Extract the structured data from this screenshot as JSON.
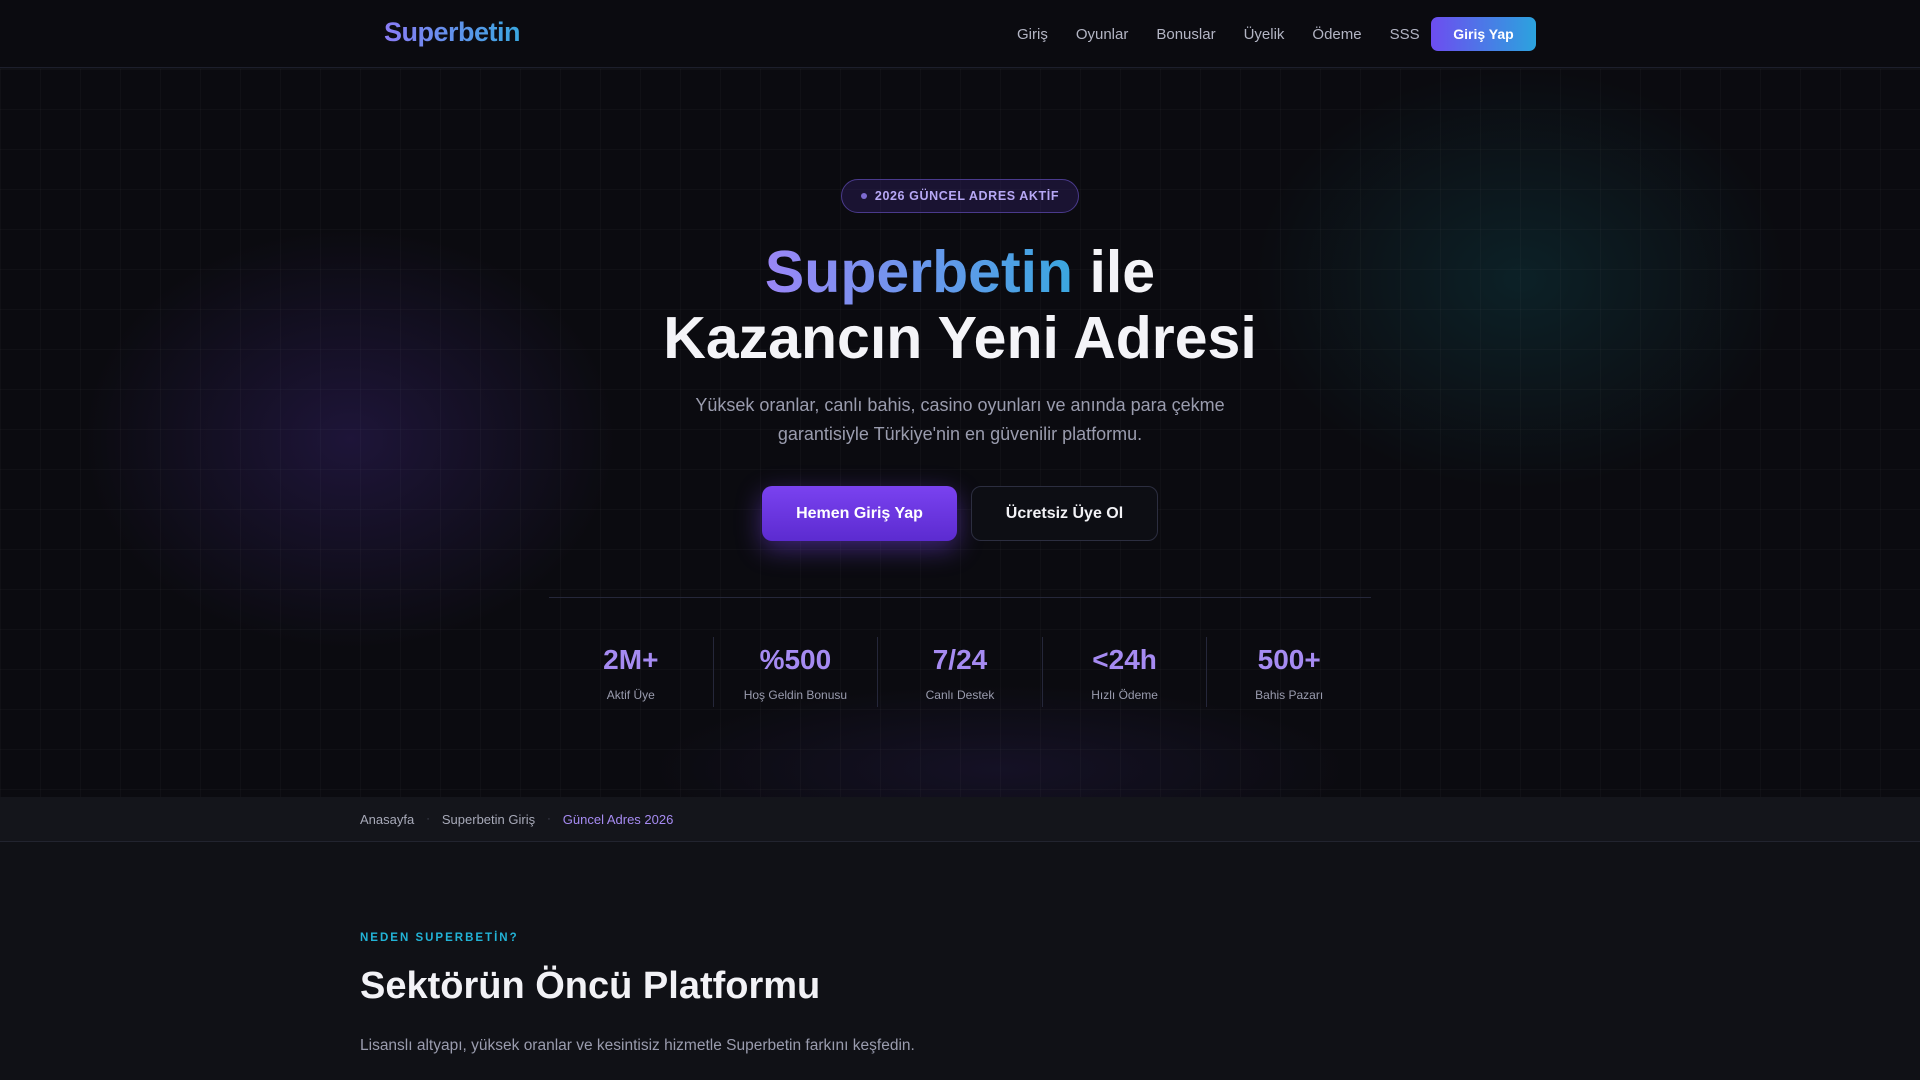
{
  "nav": {
    "logo": "Superbetin",
    "links": [
      "Giriş",
      "Oyunlar",
      "Bonuslar",
      "Üyelik",
      "Ödeme",
      "SSS"
    ],
    "cta": "Giriş Yap"
  },
  "hero": {
    "badge": "2026 GÜNCEL ADRES AKTİF",
    "title_highlight": "Superbetin",
    "title_rest_line1": " ile",
    "title_line2": "Kazancın Yeni Adresi",
    "subtitle": "Yüksek oranlar, canlı bahis, casino oyunları ve anında para çekme garantisiyle Türkiye'nin en güvenilir platformu.",
    "primary_button": "Hemen Giriş Yap",
    "secondary_button": "Ücretsiz Üye Ol",
    "stats": [
      {
        "value": "2M+",
        "label": "Aktif Üye"
      },
      {
        "value": "%500",
        "label": "Hoş Geldin Bonusu"
      },
      {
        "value": "7/24",
        "label": "Canlı Destek"
      },
      {
        "value": "<24h",
        "label": "Hızlı Ödeme"
      },
      {
        "value": "500+",
        "label": "Bahis Pazarı"
      }
    ]
  },
  "breadcrumb": {
    "items": [
      "Anasayfa",
      "Superbetin Giriş",
      "Güncel Adres 2026"
    ],
    "separator": "·"
  },
  "section": {
    "eyebrow": "NEDEN SUPERBETİN?",
    "title": "Sektörün Öncü Platformu",
    "description": "Lisanslı altyapı, yüksek oranlar ve kesintisiz hizmetle Superbetin farkını keşfedin."
  },
  "colors": {
    "accent_purple": "#a68bf2",
    "accent_cyan": "#22b3d6",
    "background": "#0b0b10"
  }
}
